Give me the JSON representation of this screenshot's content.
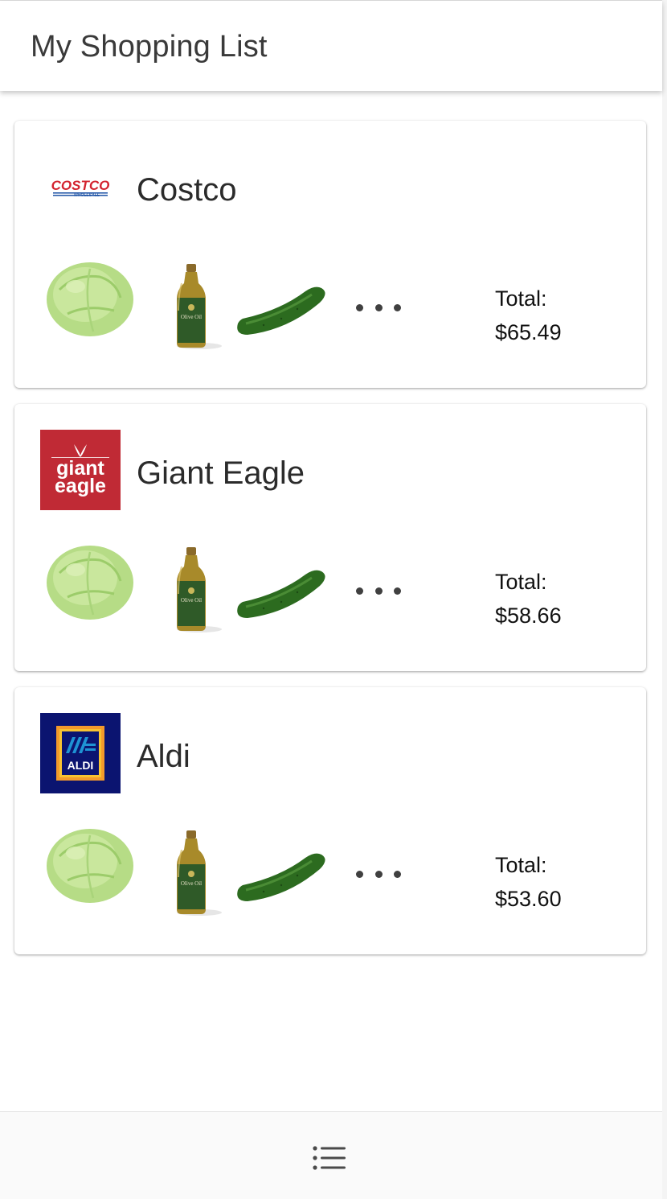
{
  "header": {
    "title": "My Shopping List"
  },
  "stores": [
    {
      "name": "Costco",
      "logo": "costco-logo",
      "items": [
        "lettuce-icon",
        "olive-oil-icon",
        "cucumber-icon"
      ],
      "more_icon": "ellipsis-icon",
      "total_label": "Total:",
      "total_value": "$65.49"
    },
    {
      "name": "Giant Eagle",
      "logo": "giant-eagle-logo",
      "items": [
        "lettuce-icon",
        "olive-oil-icon",
        "cucumber-icon"
      ],
      "more_icon": "ellipsis-icon",
      "total_label": "Total:",
      "total_value": "$58.66"
    },
    {
      "name": "Aldi",
      "logo": "aldi-logo",
      "items": [
        "lettuce-icon",
        "olive-oil-icon",
        "cucumber-icon"
      ],
      "more_icon": "ellipsis-icon",
      "total_label": "Total:",
      "total_value": "$53.60"
    }
  ],
  "logo_text": {
    "costco": {
      "line1": "COSTCO",
      "line2": "WHOLESALE"
    },
    "giant_eagle": {
      "line1": "giant",
      "line2": "eagle"
    },
    "aldi": {
      "line1": "ALDI"
    }
  },
  "bottom_nav": {
    "icon": "list-icon"
  },
  "colors": {
    "costco_red": "#d3232f",
    "costco_blue": "#2a5caa",
    "giant_eagle_red": "#c02a35",
    "aldi_navy": "#0b1470",
    "aldi_orange": "#f39a2b",
    "aldi_blue": "#1e93d4"
  }
}
